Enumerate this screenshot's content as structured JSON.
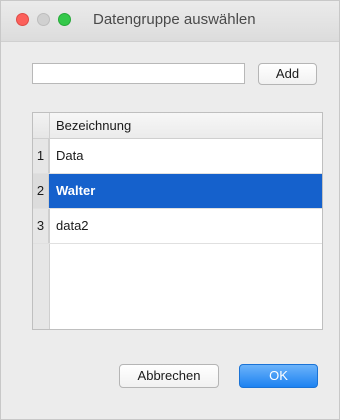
{
  "window": {
    "title": "Datengruppe auswählen"
  },
  "input": {
    "value": "",
    "placeholder": ""
  },
  "buttons": {
    "add": "Add",
    "cancel": "Abbrechen",
    "ok": "OK"
  },
  "table": {
    "column_header": "Bezeichnung",
    "rows": [
      {
        "num": "1",
        "label": "Data",
        "selected": false
      },
      {
        "num": "2",
        "label": "Walter",
        "selected": true
      },
      {
        "num": "3",
        "label": "data2",
        "selected": false
      }
    ]
  },
  "colors": {
    "selection": "#1561cc",
    "ok_button": "#1d82f1",
    "close": "#fc605b",
    "maximize": "#34c84a"
  }
}
